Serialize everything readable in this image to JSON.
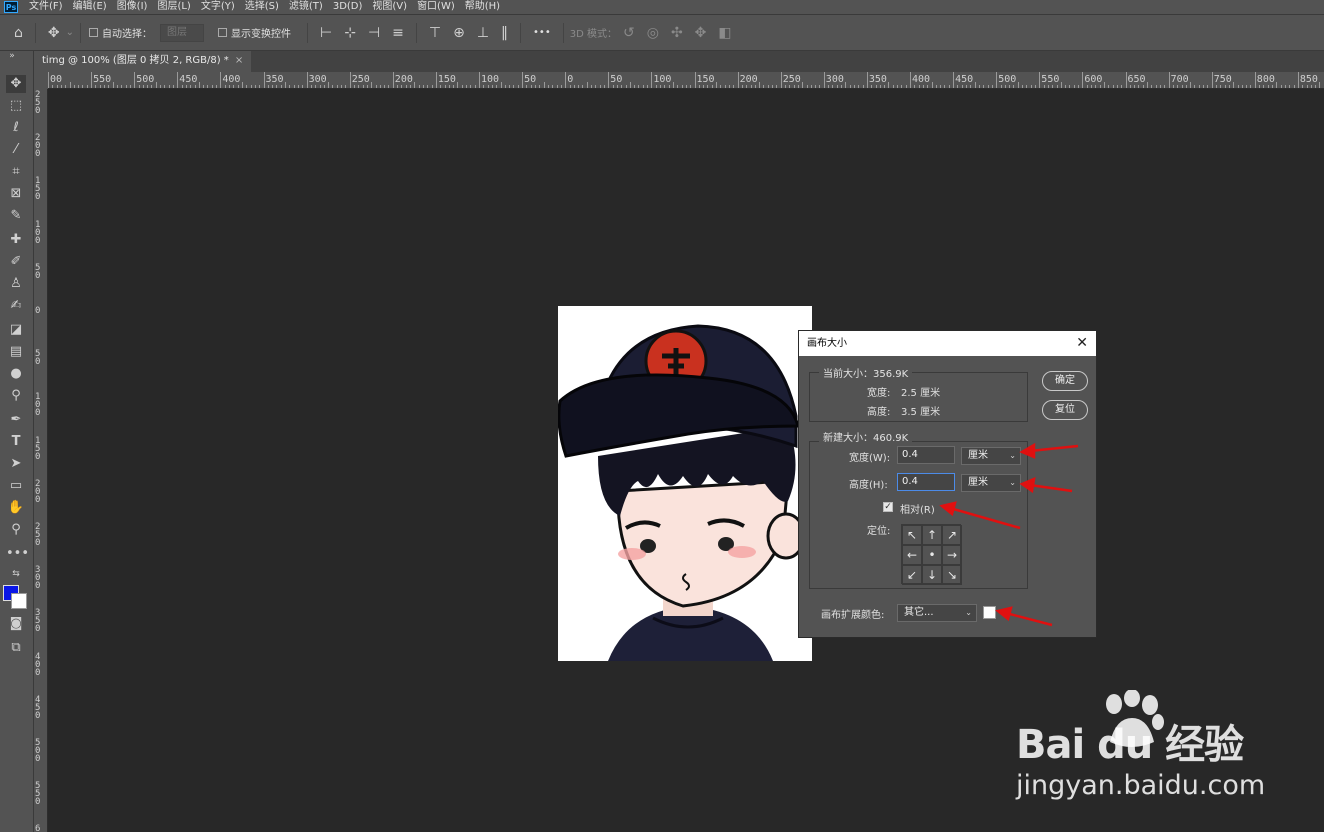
{
  "menubar": {
    "logo": "Ps",
    "items": [
      "文件(F)",
      "编辑(E)",
      "图像(I)",
      "图层(L)",
      "文字(Y)",
      "选择(S)",
      "滤镜(T)",
      "3D(D)",
      "视图(V)",
      "窗口(W)",
      "帮助(H)"
    ]
  },
  "options": {
    "auto_select": "自动选择：",
    "layer_select": "图层",
    "show_transform": "显示变换控件",
    "more": "•••",
    "mode_3d": "3D 模式："
  },
  "tab": {
    "title": "timg @ 100% (图层 0 拷贝 2, RGB/8) *",
    "close": "×"
  },
  "ruler": {
    "top_labels": [
      "00",
      "550",
      "500",
      "450",
      "400",
      "350",
      "300",
      "250",
      "200",
      "150",
      "100",
      "50",
      "0",
      "50",
      "100",
      "150",
      "200",
      "250",
      "300",
      "350",
      "400",
      "450",
      "500",
      "550",
      "600",
      "650",
      "700",
      "750",
      "800",
      "850"
    ],
    "left_labels": [
      "250",
      "200",
      "150",
      "100",
      "50",
      "0",
      "50",
      "100",
      "150",
      "200",
      "250",
      "300",
      "350",
      "400",
      "450",
      "500",
      "550",
      "6"
    ]
  },
  "dialog": {
    "title": "画布大小",
    "close": "✕",
    "current_size": "当前大小：356.9K",
    "width_label": "宽度:",
    "width_value": "2.5 厘米",
    "height_label": "高度:",
    "height_value": "3.5 厘米",
    "ok": "确定",
    "reset": "复位",
    "new_size": "新建大小：460.9K",
    "new_width_label": "宽度(W):",
    "new_width_value": "0.4",
    "new_width_unit": "厘米",
    "new_height_label": "高度(H):",
    "new_height_value": "0.4",
    "new_height_unit": "厘米",
    "relative": "相对(R)",
    "anchor_label": "定位:",
    "anchor_arrows": [
      "↖",
      "↑",
      "↗",
      "←",
      "•",
      "→",
      "↙",
      "↓",
      "↘"
    ],
    "ext_color_label": "画布扩展颜色:",
    "ext_color_value": "其它..."
  },
  "watermark": {
    "logo": "Bai du 经验",
    "url": "jingyan.baidu.com"
  },
  "colors": {
    "foreground": "#0a16e6",
    "background": "#ffffff",
    "annotation_arrow": "#e01010"
  }
}
